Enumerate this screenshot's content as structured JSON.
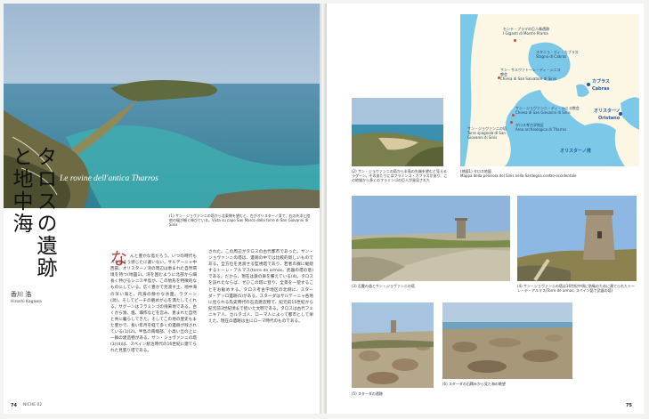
{
  "left_page": {
    "title_jp": "タロスの遺跡と地中海",
    "subtitle_it": "Le rovine dell'antica Tharros",
    "photo_caption": "(1) サン・ジョヴァンニの塔から北東側を望むと、左がオリスターノ湾で、右の外洋と陸地の幅が細く伸びている。Vista su capo San Marco dalla torre di San Giovanni di Sinis",
    "author_jp": "香川 浩",
    "author_en": "Hiroshi Kagawa",
    "dropcap": "な",
    "body_col1": "んと豊かな島だろう。いつの時代も人々はそう感じたに違いない。サルデーニャ中西部。オリスターノ湾の周辺は恵まれた自然環境を持つ(地図1)。湾を囲むように北部から細長く伸びるシニス半島が、この地形を特徴的なものにしている。広く豊かで見渡す土、地中海の深い海と、内海の静かな水面。ラグーン(潟)、そしてビーチの眺めが心を満たしてくれる。サグーンはフラミンゴの飛来地である。古くから漁、塩、畑作などを営み、恵まれた自然と共に暮らしてきた。そしてこの地の歴史もまた豊かで、長い年月を経て多くの遺跡が残されている(1)(2)。半島の南端部、小高い丘の上に一群の建造物がある。サン・ジョヴァンニの塔(3)(4)は、スペイン統治時代の16世紀に建てられた見張り塔である。",
    "body_col2": "された。この周辺がタロスの古代都市であった。サン・ジョヴァンニの塔は、遺跡の中では比較的新しいものである。全方位を見渡せる監視塔であり、若者の群に継続するトーレ・アルマス(torre de armas、武器の塔の意)である。だから、現在は鉄の扉を備えている(4)。タロスを訪れたならば、ぜひこの塔に登り、全景を一望することをお勧めする。タロス考古学地区の北側に、スターダ・デッロ遺跡(5)がある。スターダはサルデーニャ各地に見られる先史時代の石造建造物で、紀元前15世紀から紀元前3世紀頃まで続いた文明である。タロスは古代フェニキア人、カルタゴ人、ローマ人によって都市として栄えた。現在の遺跡は主にローマ時代のものである。"
  },
  "right_page": {
    "map": {
      "caption": "(地図1) タロス地図\nMappa della penisola del Sinis nella Sardegna centro-occidentale",
      "labels": {
        "giganti": "モンテ・プラマの巨人像遺跡\nI Giganti di Mont'e Prama",
        "cabras_lagoon": "スタニョ・ディ・カブラス\nStagno di Cabras",
        "salvatore": "サン・サルヴァトーレ・ディ・シニス教会\nChiesa di San Salvatore di Sinis",
        "sgiovanni_church": "サン・ジョヴァンニ・ディ・シニス教会\nChiesa di San Giovanni di Sinis",
        "torre": "サン・ジョヴァンニの塔\nTorre spagnola di San Giovanni di Sinis",
        "tharros": "タロス考古学地区\nArea archeologica di Tharros",
        "cabras_city_jp": "カブラス",
        "cabras_city_it": "Cabras",
        "oristano_jp": "オリスターノ",
        "oristano_it": "Oristano",
        "gulf": "オリスターノ湾"
      }
    },
    "photo2_caption": "(2) サン・ジョヴァンニの塔から半島の先端を望むと見えるラグーン。そのあたりにはフラミンゴ・カブラスがあり、この地域から多くのフラミンゴの巨人が発見された",
    "photo3_caption": "(3) 石畳の道とサン・ジョヴァンニの塔",
    "photo4_caption": "(4) サン・ジョヴァンニの塔は16世紀中頃に防衛のために建てられたトーレ・デ・アルマス(Torre de armas, スペイン語で武器の塔)",
    "photo5_caption": "(5) スターダの遺跡",
    "photo6_caption": "(6) スターダの石積みから見た海の眺望"
  },
  "footer": {
    "left_page_number": "74",
    "left_magazine": "NICHE 02",
    "right_page_number": "75"
  },
  "colors": {
    "sea": "#3a8fa8",
    "map_sea": "#7cc8e8",
    "map_land": "#fbf7e4",
    "accent_marker": "#d9432a"
  }
}
